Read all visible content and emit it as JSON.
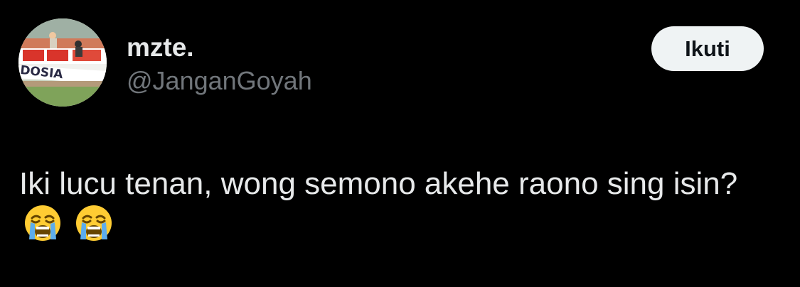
{
  "tweet": {
    "display_name": "mzte.",
    "handle": "@JanganGoyah",
    "follow_label": "Ikuti",
    "text": "Iki lucu tenan, wong semono akehe raono sing isin?",
    "emojis": [
      "loudly-crying-face-icon",
      "loudly-crying-face-icon"
    ]
  },
  "avatar": {
    "banner_text": "DOSIA"
  },
  "colors": {
    "background": "#000000",
    "primary_text": "#e7e9ea",
    "secondary_text": "#71767b",
    "button_bg": "#eff3f4",
    "button_text": "#0f1419"
  }
}
